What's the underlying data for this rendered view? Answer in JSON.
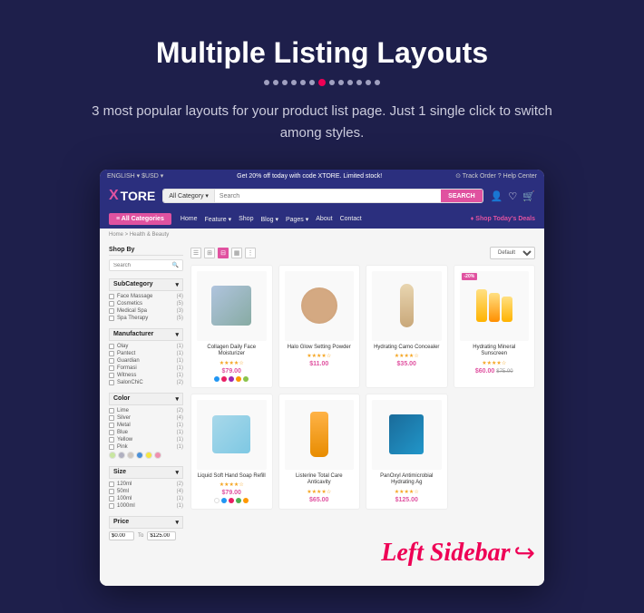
{
  "page": {
    "title": "Multiple Listing Layouts",
    "subtitle": "3 most popular layouts for your product list page. Just 1 single click to switch among styles.",
    "dots": [
      {
        "active": false
      },
      {
        "active": false
      },
      {
        "active": false
      },
      {
        "active": false
      },
      {
        "active": false
      },
      {
        "active": false
      },
      {
        "active": true
      },
      {
        "active": false
      },
      {
        "active": false
      },
      {
        "active": false
      },
      {
        "active": false
      },
      {
        "active": false
      },
      {
        "active": false
      }
    ]
  },
  "store": {
    "topbar": {
      "left": "ENGLISH ▾   $USD ▾",
      "promo": "Get 20% off today with code XTORE. Limited stock!",
      "right": "⊙ Track Order   ? Help Center"
    },
    "logo": "TORE",
    "logo_x": "X",
    "search": {
      "category": "All Category ▾",
      "placeholder": "Search",
      "button": "SEARCH"
    },
    "nav": {
      "all_categories": "≡  All Categories",
      "links": [
        "Home",
        "Feature ▾",
        "Shop",
        "Blog ▾",
        "Pages ▾",
        "About",
        "Contact"
      ],
      "deals": "♦ Shop Today's Deals"
    },
    "breadcrumb": "Home > Health & Beauty",
    "shop_by": "Shop By",
    "search_sidebar": "Search",
    "sidebar_groups": [
      {
        "title": "SubCategory",
        "items": [
          {
            "label": "Face Massage",
            "count": "(4)"
          },
          {
            "label": "Cosmetics",
            "count": "(5)"
          },
          {
            "label": "Medical Spa",
            "count": "(3)"
          },
          {
            "label": "Spa Therapy",
            "count": "(5)"
          }
        ]
      },
      {
        "title": "Manufacturer",
        "items": [
          {
            "label": "Olay",
            "count": "(1)"
          },
          {
            "label": "Pantect",
            "count": "(1)"
          },
          {
            "label": "Guardian",
            "count": "(1)"
          },
          {
            "label": "Formasi",
            "count": "(1)"
          },
          {
            "label": "Witness",
            "count": "(1)"
          },
          {
            "label": "SalonChiC",
            "count": "(2)"
          }
        ]
      },
      {
        "title": "Color",
        "items": [
          {
            "label": "Lime",
            "count": "(2)"
          },
          {
            "label": "Silver",
            "count": "(4)"
          },
          {
            "label": "Metal",
            "count": "(1)"
          },
          {
            "label": "Blue",
            "count": "(1)"
          },
          {
            "label": "Yellow",
            "count": "(1)"
          },
          {
            "label": "Pink",
            "count": "(1)"
          }
        ],
        "swatches": [
          "#c8e6a0",
          "#b0b0c0",
          "#d0c8c0",
          "#4a90d9",
          "#f5e642",
          "#f090b0"
        ]
      },
      {
        "title": "Size",
        "items": [
          {
            "label": "120ml",
            "count": "(2)"
          },
          {
            "label": "50ml",
            "count": "(4)"
          },
          {
            "label": "100ml",
            "count": "(1)"
          },
          {
            "label": "1000ml",
            "count": "(1)"
          }
        ]
      },
      {
        "title": "Price",
        "range_min": "$0.00",
        "range_max": "$125.00"
      }
    ],
    "products": [
      {
        "name": "Collagen Daily Face Moisturizer",
        "price": "$79.00",
        "old_price": "",
        "stars": "★★★★☆",
        "colors": [
          "#2196f3",
          "#e91e63",
          "#9c27b0",
          "#ff9800",
          "#8bc34a"
        ],
        "badge": "",
        "type": "cream"
      },
      {
        "name": "Halo Glow Setting Powder",
        "price": "$11.00",
        "old_price": "",
        "stars": "★★★★☆",
        "colors": [],
        "badge": "",
        "type": "powder"
      },
      {
        "name": "Hydrating Camo Concealer",
        "price": "$35.00",
        "old_price": "",
        "stars": "★★★★☆",
        "colors": [],
        "badge": "",
        "type": "concealer"
      },
      {
        "name": "Hydrating Mineral Sunscreen",
        "price": "$60.00",
        "old_price": "$75.00",
        "stars": "★★★★☆",
        "colors": [],
        "badge": "-20%",
        "type": "sunscreen"
      },
      {
        "name": "Liquid Soft Hand Soap Refill",
        "price": "$79.00",
        "old_price": "",
        "stars": "★★★★☆",
        "colors": [
          "#ffffff",
          "#2196f3",
          "#e91e63",
          "#4caf50",
          "#ff9800"
        ],
        "badge": "",
        "type": "soap"
      },
      {
        "name": "Listerine Total Care Anticavity",
        "price": "$65.00",
        "old_price": "",
        "stars": "★★★★☆",
        "colors": [],
        "badge": "",
        "type": "listerine"
      },
      {
        "name": "PanOxyl Antimicrobial Hydrating Ag",
        "price": "$125.00",
        "old_price": "",
        "stars": "★★★★☆",
        "colors": [],
        "badge": "",
        "type": "antibacterial"
      }
    ],
    "sort_label": "Default",
    "label_annotation": "Left Sidebar"
  }
}
